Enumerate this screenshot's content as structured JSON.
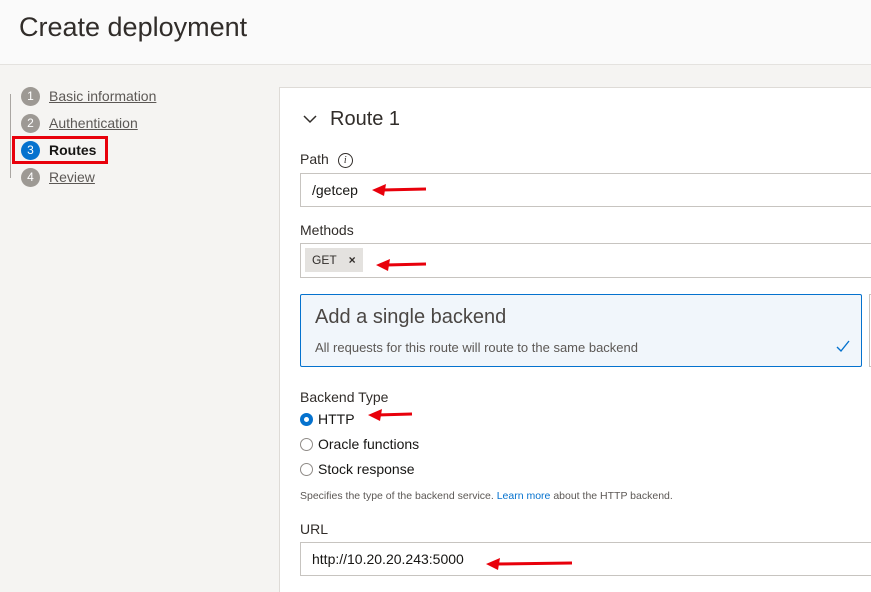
{
  "header": {
    "title": "Create deployment"
  },
  "steps": [
    {
      "number": "1",
      "label": "Basic information"
    },
    {
      "number": "2",
      "label": "Authentication"
    },
    {
      "number": "3",
      "label": "Routes"
    },
    {
      "number": "4",
      "label": "Review"
    }
  ],
  "route": {
    "title": "Route 1",
    "path_label": "Path",
    "path_value": "/getcep",
    "methods_label": "Methods",
    "methods": [
      "GET"
    ],
    "chip_remove": "×",
    "backend_card": {
      "title": "Add a single backend",
      "description": "All requests for this route will route to the same backend"
    },
    "backend_type_label": "Backend Type",
    "backend_types": [
      "HTTP",
      "Oracle functions",
      "Stock response"
    ],
    "selected_backend_type": "HTTP",
    "helper_prefix": "Specifies the type of the backend service.",
    "helper_link": "Learn more",
    "helper_suffix": "about the HTTP backend.",
    "url_label": "URL",
    "url_value": "http://10.20.20.243:5000"
  },
  "colors": {
    "accent": "#0572ce",
    "annotation": "#e8000b"
  }
}
